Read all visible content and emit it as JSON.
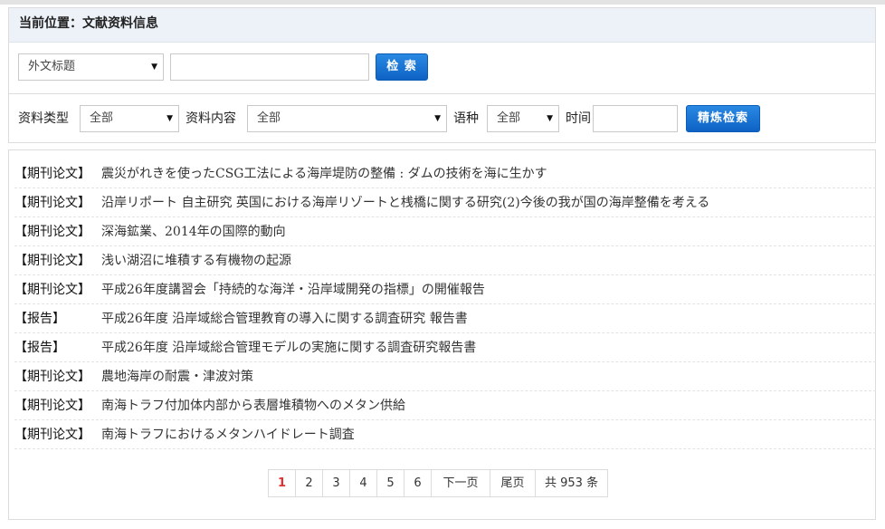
{
  "breadcrumb": "当前位置：文献资料信息",
  "search": {
    "field_select": "外文标题",
    "query_value": "",
    "search_button": "检 索"
  },
  "filters": {
    "type_label": "资料类型",
    "type_value": "全部",
    "content_label": "资料内容",
    "content_value": "全部",
    "lang_label": "语种",
    "lang_value": "全部",
    "time_label": "时间",
    "time_value": "",
    "refine_button": "精炼检索"
  },
  "results": [
    {
      "tag": "【期刊论文】",
      "title": "震災がれきを使ったCSG工法による海岸堤防の整備 : ダムの技術を海に生かす"
    },
    {
      "tag": "【期刊论文】",
      "title": "沿岸リポート 自主研究 英国における海岸リゾートと桟橋に関する研究(2)今後の我が国の海岸整備を考える"
    },
    {
      "tag": "【期刊论文】",
      "title": "深海鉱業、2014年の国際的動向"
    },
    {
      "tag": "【期刊论文】",
      "title": "浅い湖沼に堆積する有機物の起源"
    },
    {
      "tag": "【期刊论文】",
      "title": "平成26年度講習会「持続的な海洋・沿岸域開発の指標」の開催報告"
    },
    {
      "tag": "【报告】",
      "title": "平成26年度 沿岸域総合管理教育の導入に関する調査研究 報告書"
    },
    {
      "tag": "【报告】",
      "title": "平成26年度 沿岸域総合管理モデルの実施に関する調査研究報告書"
    },
    {
      "tag": "【期刊论文】",
      "title": "農地海岸の耐震・津波対策"
    },
    {
      "tag": "【期刊论文】",
      "title": "南海トラフ付加体内部から表層堆積物へのメタン供給"
    },
    {
      "tag": "【期刊论文】",
      "title": "南海トラフにおけるメタンハイドレート調査"
    }
  ],
  "pager": {
    "pages": [
      "1",
      "2",
      "3",
      "4",
      "5",
      "6"
    ],
    "current": "1",
    "next": "下一页",
    "last": "尾页",
    "total": "共 953 条"
  },
  "icons": {
    "dropdown": "caret-down-icon"
  },
  "colors": {
    "button": "#0e62c4",
    "current_page": "#e03131",
    "breadcrumb_bg": "#edf2f9"
  }
}
